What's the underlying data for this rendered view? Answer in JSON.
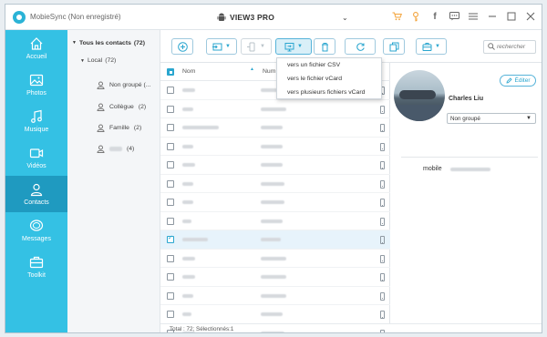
{
  "app": {
    "title": "MobieSync (Non enregistré)",
    "device": "VIEW3 PRO"
  },
  "sidebar": {
    "items": [
      {
        "label": "Accueil",
        "icon": "home-icon"
      },
      {
        "label": "Photos",
        "icon": "photos-icon"
      },
      {
        "label": "Musique",
        "icon": "music-icon"
      },
      {
        "label": "Vidéos",
        "icon": "video-icon"
      },
      {
        "label": "Contacts",
        "icon": "contacts-icon",
        "active": true
      },
      {
        "label": "Messages",
        "icon": "messages-icon"
      },
      {
        "label": "Toolkit",
        "icon": "toolkit-icon"
      }
    ]
  },
  "tree": {
    "root": "Tous les contacts",
    "root_count": "(72)",
    "local": "Local",
    "local_count": "(72)",
    "groups": [
      {
        "label": "Non groupé",
        "count": "(..."
      },
      {
        "label": "Collègue",
        "count": "(2)"
      },
      {
        "label": "Famille",
        "count": "(2)"
      },
      {
        "label": "",
        "count": "(4)"
      }
    ]
  },
  "toolbar": {
    "search_placeholder": "rechercher"
  },
  "export_menu": {
    "items": [
      "vers un fichier CSV",
      "vers le fichier vCard",
      "vers plusieurs fichiers vCard"
    ]
  },
  "table": {
    "col_name": "Nom",
    "col_number": "Num",
    "rows": [
      {
        "selected": false
      },
      {
        "selected": false
      },
      {
        "selected": false
      },
      {
        "selected": false
      },
      {
        "selected": false
      },
      {
        "selected": false
      },
      {
        "selected": false
      },
      {
        "selected": false
      },
      {
        "selected": true
      },
      {
        "selected": false
      },
      {
        "selected": false
      },
      {
        "selected": false
      },
      {
        "selected": false
      },
      {
        "selected": false
      }
    ]
  },
  "status": {
    "text": "Total : 72; Sélectionnés:1"
  },
  "detail": {
    "edit_label": "Éditer",
    "name": "Charles Liu",
    "group": "Non groupé",
    "mobile_label": "mobile"
  },
  "colors": {
    "accent": "#34c1e4",
    "accent_dark": "#1f9ac0",
    "icon_blue": "#2aa6cf"
  }
}
